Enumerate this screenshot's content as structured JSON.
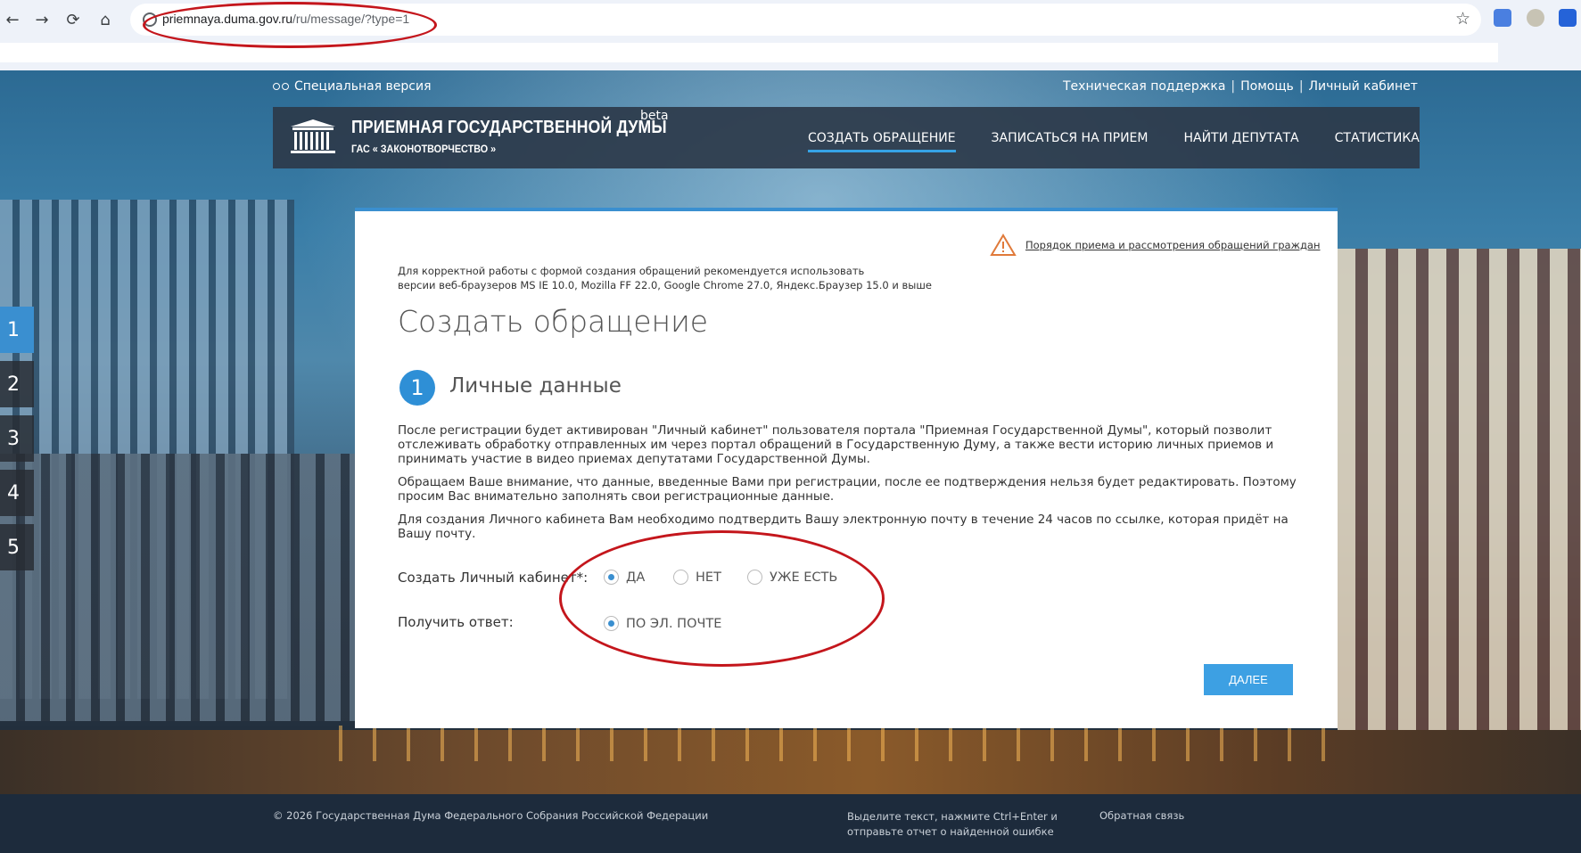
{
  "browser": {
    "url_host": "priemnaya.duma.gov.ru",
    "url_path": "/ru/message/?type=1"
  },
  "top_bar": {
    "special_version": "Специальная версия",
    "links": [
      "Техническая поддержка",
      "Помощь",
      "Личный кабинет"
    ]
  },
  "header": {
    "title": "ПРИЕМНАЯ ГОСУДАРСТВЕННОЙ ДУМЫ",
    "subtitle": "ГАС « ЗАКОНОТВОРЧЕСТВО »",
    "beta": "beta",
    "nav": [
      "СОЗДАТЬ ОБРАЩЕНИЕ",
      "ЗАПИСАТЬСЯ НА ПРИЕМ",
      "НАЙТИ ДЕПУТАТА",
      "СТАТИСТИКА"
    ],
    "active_nav": "СОЗДАТЬ ОБРАЩЕНИЕ"
  },
  "steps": [
    "1",
    "2",
    "3",
    "4",
    "5"
  ],
  "active_step": "1",
  "card": {
    "notice_link": "Порядок приема и рассмотрения обращений граждан",
    "browsers_line1": "Для корректной работы с формой создания обращений рекомендуется использовать",
    "browsers_line2": "версии веб-браузеров MS IE 10.0, Mozilla FF 22.0, Google Chrome 27.0, Яндекс.Браузер 15.0 и выше",
    "title": "Создать обращение",
    "section_number": "1",
    "section_title": "Личные данные",
    "para1": "После регистрации будет активирован \"Личный кабинет\" пользователя портала \"Приемная Государственной Думы\", который позволит отслеживать обработку отправленных им через портал обращений в Государственную Думу, а также вести историю личных приемов и принимать участие в видео приемах депутатами Государственной Думы.",
    "para2": "Обращаем Ваше внимание, что данные, введенные Вами при регистрации, после ее подтверждения нельзя будет редактировать. Поэтому просим Вас внимательно заполнять свои регистрационные данные.",
    "para3": "Для создания Личного кабинета Вам необходимо подтвердить Вашу электронную почту в течение 24 часов по ссылке, которая придёт на Вашу почту.",
    "create_cabinet_label": "Создать Личный кабинет*:",
    "create_options": [
      "ДА",
      "НЕТ",
      "УЖЕ ЕСТЬ"
    ],
    "create_selected": "ДА",
    "receive_label": "Получить ответ:",
    "receive_options": [
      "ПО ЭЛ. ПОЧТЕ"
    ],
    "receive_selected": "ПО ЭЛ. ПОЧТЕ",
    "next_button": "ДАЛЕЕ"
  },
  "footer": {
    "copyright": "© 2026 Государственная Дума Федерального Собрания Российской Федерации",
    "report_line1": "Выделите текст, нажмите Ctrl+Enter и",
    "report_line2": "отправьте отчет о найденной ошибке",
    "feedback": "Обратная связь"
  },
  "colors": {
    "accent": "#3a8fd0",
    "button": "#3da0e3",
    "annotation": "#c4161c",
    "header_bg": "#2d3a4a",
    "footer_bg": "#1d2b3c"
  }
}
